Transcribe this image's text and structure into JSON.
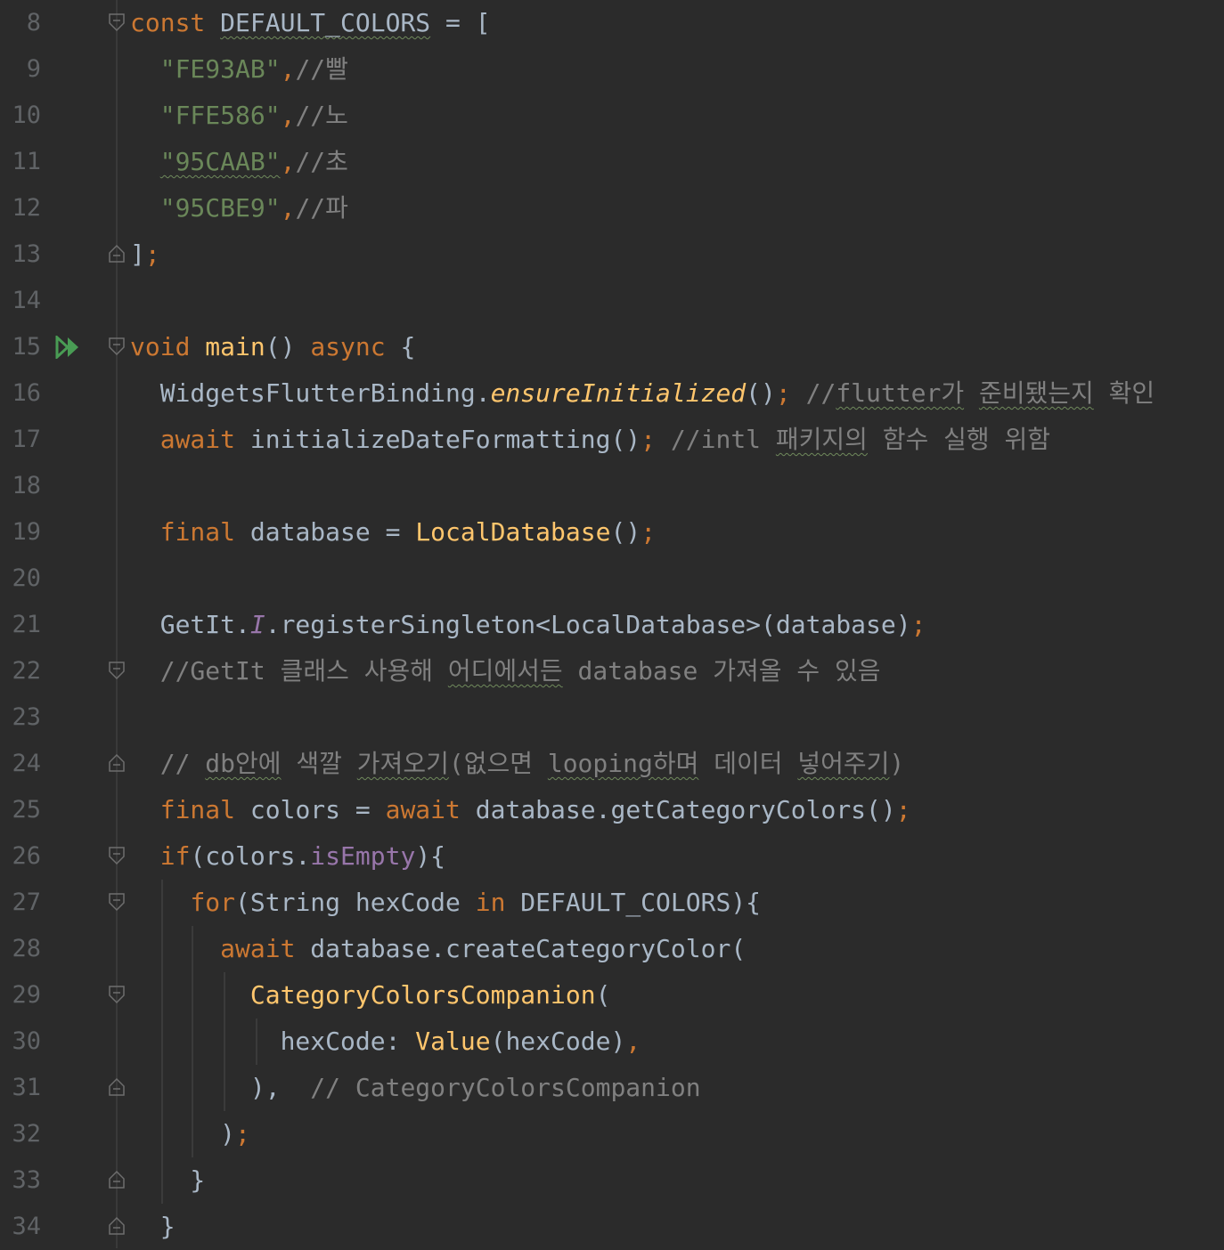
{
  "editor": {
    "line_numbers": [
      "8",
      "9",
      "10",
      "11",
      "12",
      "13",
      "14",
      "15",
      "16",
      "17",
      "18",
      "19",
      "20",
      "21",
      "22",
      "23",
      "24",
      "25",
      "26",
      "27",
      "28",
      "29",
      "30",
      "31",
      "32",
      "33",
      "34"
    ],
    "run_icon": "run-gutter-icon",
    "fold_icon": "fold-marker-icon",
    "lines": {
      "l8": [
        "const",
        " ",
        "DEFAULT_COLORS",
        " = ["
      ],
      "l9": [
        "  ",
        "\"FE93AB\"",
        ",",
        "//빨"
      ],
      "l10": [
        "  ",
        "\"FFE586\"",
        ",",
        "//노"
      ],
      "l11": [
        "  ",
        "\"95CAAB\"",
        ",",
        "//초"
      ],
      "l12": [
        "  ",
        "\"95CBE9\"",
        ",",
        "//파"
      ],
      "l13": [
        "]",
        ";"
      ],
      "l15": [
        "void",
        " ",
        "main",
        "() ",
        "async",
        " {"
      ],
      "l16": [
        "  WidgetsFlutterBinding.",
        "ensureInitialized",
        "()",
        ";",
        " //",
        "flutter가",
        " ",
        "준비됐는지",
        " 확인"
      ],
      "l17": [
        "  ",
        "await",
        " initializeDateFormatting()",
        ";",
        " //intl ",
        "패키지의",
        " 함수 실행 위함"
      ],
      "l19": [
        "  ",
        "final",
        " database = ",
        "LocalDatabase",
        "()",
        ";"
      ],
      "l21": [
        "  GetIt.",
        "I",
        ".registerSingleton<LocalDatabase>(database)",
        ";"
      ],
      "l22": [
        "  //GetIt 클래스 사용해 ",
        "어디에서든",
        " database 가져올 수 있음"
      ],
      "l24": [
        "  // ",
        "db안에",
        " 색깔 ",
        "가져오기",
        "(없으면 ",
        "looping하며",
        " 데이터 ",
        "넣어주기",
        ")"
      ],
      "l25": [
        "  ",
        "final",
        " colors = ",
        "await",
        " database.getCategoryColors()",
        ";"
      ],
      "l26": [
        "  ",
        "if",
        "(colors.",
        "isEmpty",
        "){"
      ],
      "l27": [
        "    ",
        "for",
        "(String hexCode ",
        "in",
        " DEFAULT_COLORS){"
      ],
      "l28": [
        "      ",
        "await",
        " database.createCategoryColor("
      ],
      "l29": [
        "        ",
        "CategoryColorsCompanion",
        "("
      ],
      "l30": [
        "          hexCode: ",
        "Value",
        "(hexCode)",
        ","
      ],
      "l31": [
        "        ),",
        "  // CategoryColorsCompanion"
      ],
      "l32": [
        "      )",
        ";"
      ],
      "l33": [
        "    }"
      ],
      "l34": [
        "  }"
      ]
    }
  },
  "colors": {
    "background": "#2b2b2b",
    "keyword": "#cc7832",
    "string": "#6a8759",
    "comment": "#808080",
    "function": "#ffc66d",
    "property": "#9876aa",
    "text": "#a9b7c6",
    "line_number": "#606366",
    "run_icon": "#499c54"
  }
}
